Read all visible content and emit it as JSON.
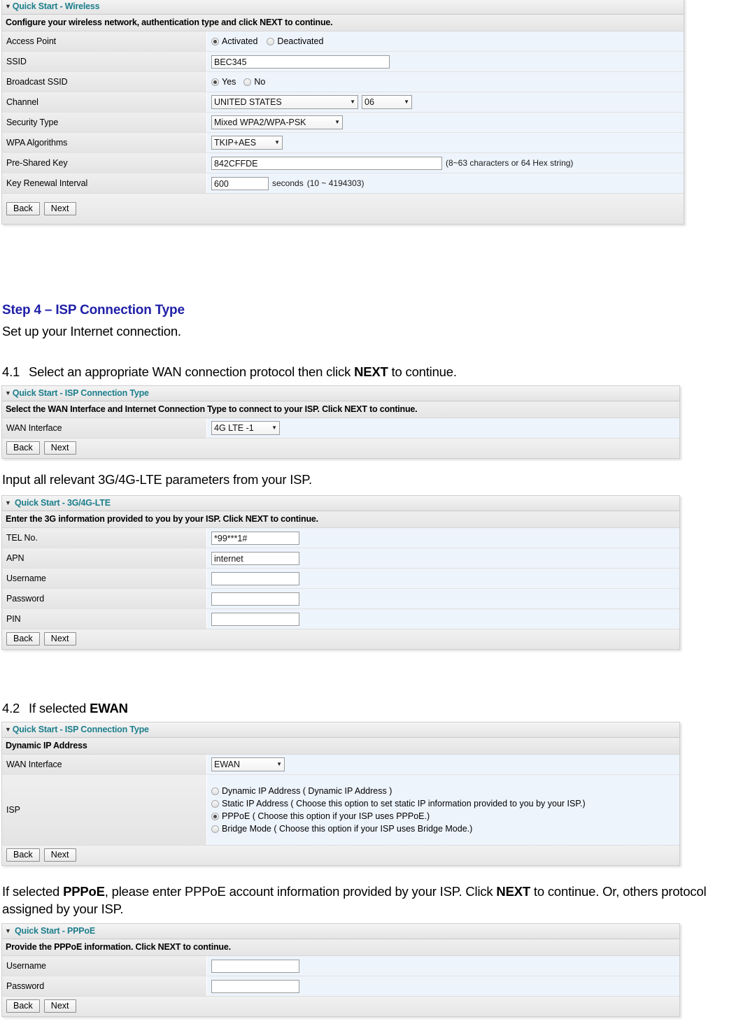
{
  "wireless_panel": {
    "title": "Quick Start - Wireless",
    "description": "Configure your wireless network, authentication type and click NEXT to continue.",
    "rows": {
      "access_point": {
        "label": "Access Point",
        "options": [
          {
            "label": "Activated",
            "selected": true
          },
          {
            "label": "Deactivated",
            "selected": false
          }
        ]
      },
      "ssid": {
        "label": "SSID",
        "value": "BEC345"
      },
      "broadcast_ssid": {
        "label": "Broadcast SSID",
        "options": [
          {
            "label": "Yes",
            "selected": true
          },
          {
            "label": "No",
            "selected": false
          }
        ]
      },
      "channel": {
        "label": "Channel",
        "country": "UNITED STATES",
        "number": "06"
      },
      "security_type": {
        "label": "Security Type",
        "value": "Mixed WPA2/WPA-PSK"
      },
      "wpa_algorithms": {
        "label": "WPA Algorithms",
        "value": "TKIP+AES"
      },
      "pre_shared_key": {
        "label": "Pre-Shared Key",
        "value": "842CFFDE",
        "hint": "(8~63 characters or 64 Hex string)"
      },
      "key_renewal_interval": {
        "label": "Key Renewal Interval",
        "value": "600",
        "unit": "seconds",
        "hint": "(10 ~ 4194303)"
      }
    },
    "buttons": {
      "back": "Back",
      "next": "Next"
    }
  },
  "doc": {
    "step4_heading": "Step 4 – ISP Connection Type",
    "step4_sub": "Set up your Internet connection.",
    "item_41_num": "4.1",
    "item_41_a": "Select an appropriate WAN connection protocol then click ",
    "item_41_b": "NEXT",
    "item_41_c": " to continue.",
    "lte_intro": "Input all relevant 3G/4G-LTE parameters from your ISP.",
    "item_42_num": "4.2",
    "item_42_a": "If selected ",
    "item_42_b": "EWAN",
    "pppoe_note_a": "If selected ",
    "pppoe_note_b": "PPPoE",
    "pppoe_note_c": ", please enter PPPoE account information provided by your ISP. Click ",
    "pppoe_note_d": "NEXT",
    "pppoe_note_e": " to continue. Or, others protocol assigned by your ISP."
  },
  "isp_type_panel": {
    "title": "Quick Start - ISP Connection Type",
    "description": "Select the WAN Interface and Internet Connection Type to connect to your ISP. Click NEXT to continue.",
    "wan_interface": {
      "label": "WAN Interface",
      "value": "4G LTE -1"
    },
    "buttons": {
      "back": "Back",
      "next": "Next"
    }
  },
  "lte_panel": {
    "title": "Quick Start - 3G/4G-LTE",
    "description": "Enter the 3G information provided to you by your ISP. Click NEXT to continue.",
    "fields": [
      {
        "label": "TEL No.",
        "value": "*99***1#"
      },
      {
        "label": "APN",
        "value": "internet"
      },
      {
        "label": "Username",
        "value": ""
      },
      {
        "label": "Password",
        "value": ""
      },
      {
        "label": "PIN",
        "value": ""
      }
    ],
    "buttons": {
      "back": "Back",
      "next": "Next"
    }
  },
  "ewan_panel": {
    "title": "Quick Start - ISP Connection Type",
    "subhead": "Dynamic IP Address",
    "wan_interface": {
      "label": "WAN Interface",
      "value": "EWAN"
    },
    "isp": {
      "label": "ISP",
      "options": [
        {
          "label": "Dynamic IP Address ( Dynamic IP Address )",
          "selected": false
        },
        {
          "label": "Static IP Address ( Choose this option to set static IP information provided to you by your ISP.)",
          "selected": false
        },
        {
          "label": "PPPoE ( Choose this option if your ISP uses PPPoE.)",
          "selected": true
        },
        {
          "label": "Bridge Mode ( Choose this option if your ISP uses Bridge Mode.)",
          "selected": false
        }
      ]
    },
    "buttons": {
      "back": "Back",
      "next": "Next"
    }
  },
  "pppoe_panel": {
    "title": "Quick Start - PPPoE",
    "description": "Provide the PPPoE information. Click NEXT to continue.",
    "fields": [
      {
        "label": "Username",
        "value": ""
      },
      {
        "label": "Password",
        "value": ""
      }
    ],
    "buttons": {
      "back": "Back",
      "next": "Next"
    }
  },
  "colors": {
    "panel_title_text": "#1d7f8c",
    "heading_blue": "#1f1fa8",
    "row_value_bg": "#eef4fc",
    "row_label_bg": "#e9e9e9"
  }
}
